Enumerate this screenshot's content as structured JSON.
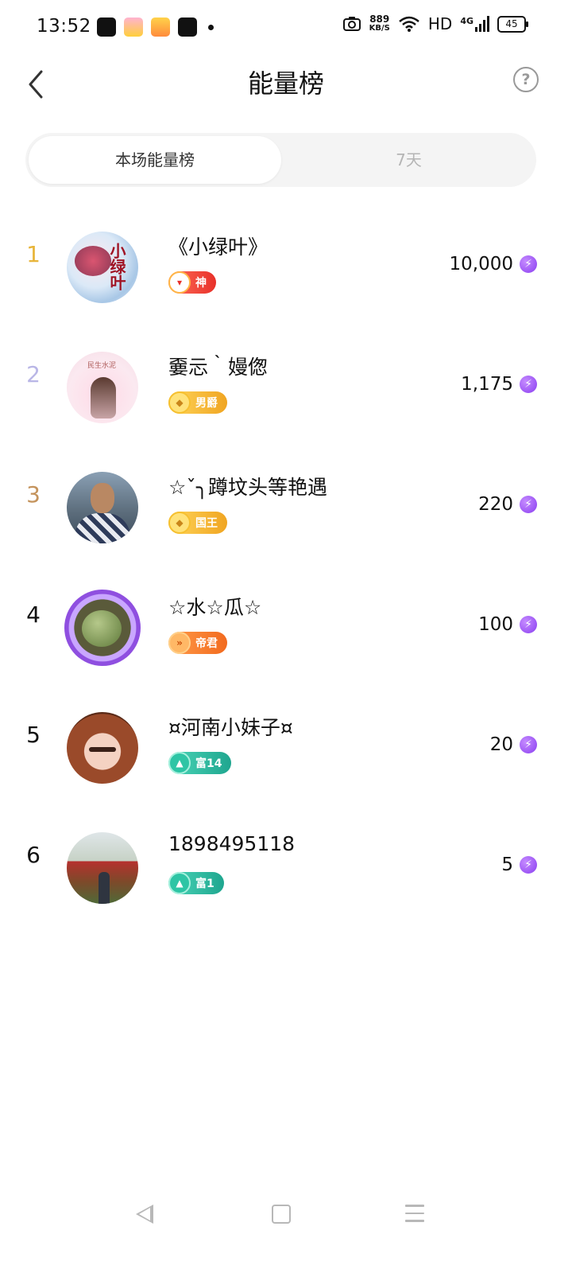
{
  "status_bar": {
    "time": "13:52",
    "net_speed_value": "889",
    "net_speed_unit": "KB/S",
    "hd": "HD",
    "network": "4G",
    "battery": "45"
  },
  "header": {
    "title": "能量榜",
    "help_glyph": "?"
  },
  "tabs": [
    {
      "label": "本场能量榜",
      "active": true
    },
    {
      "label": "7天",
      "active": false
    }
  ],
  "rankings": [
    {
      "rank": "1",
      "rank_color": "#e8b53a",
      "name": "《小绿叶》",
      "badge": "神",
      "badge_style": "red",
      "badge_icon": "▾",
      "score": "10,000"
    },
    {
      "rank": "2",
      "rank_color": "#b9b6e6",
      "name": "嫑忈｀嫚偬",
      "badge": "男爵",
      "badge_style": "gold",
      "badge_icon": "◆",
      "score": "1,175"
    },
    {
      "rank": "3",
      "rank_color": "#c4935c",
      "name": "☆ˇ╮蹲坟头等艳遇",
      "badge": "国王",
      "badge_style": "gold",
      "badge_icon": "◆",
      "score": "220"
    },
    {
      "rank": "4",
      "rank_color": "#111111",
      "name": "☆水☆瓜☆",
      "badge": "帝君",
      "badge_style": "orange",
      "badge_icon": "»",
      "score": "100"
    },
    {
      "rank": "5",
      "rank_color": "#111111",
      "name": "¤河南小妹子¤",
      "badge": "富14",
      "badge_style": "teal",
      "badge_icon": "▲",
      "score": "20"
    },
    {
      "rank": "6",
      "rank_color": "#111111",
      "name": "1898495118",
      "badge": "富1",
      "badge_style": "teal",
      "badge_icon": "▲",
      "score": "5"
    }
  ],
  "avatar_text": {
    "a1_calligraphy": "小绿叶",
    "a2_tag": "民生水泥"
  },
  "energy_icon": "⚡",
  "icons": [
    "back-arrow-icon",
    "help-icon",
    "energy-bolt-icon",
    "nav-back-icon",
    "nav-home-icon",
    "nav-menu-icon"
  ]
}
